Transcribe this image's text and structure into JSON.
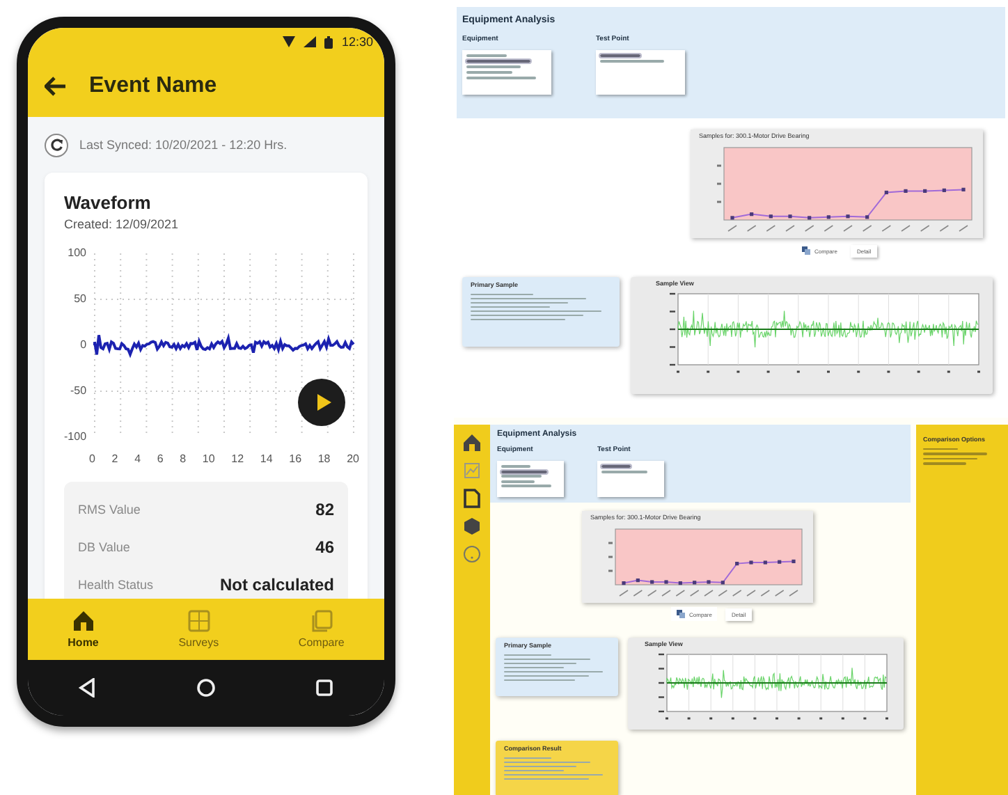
{
  "phone": {
    "status_bar": {
      "time": "12:30"
    },
    "title": "Event Name",
    "sync_status": "Last Synced: 10/20/2021 - 12:20 Hrs.",
    "card": {
      "title": "Waveform",
      "created": "Created: 12/09/2021",
      "y_labels": [
        "100",
        "50",
        "0",
        "-50",
        "-100"
      ],
      "x_labels": [
        "0",
        "2",
        "4",
        "6",
        "8",
        "10",
        "12",
        "14",
        "16",
        "18",
        "20"
      ],
      "stats": [
        {
          "label": "RMS Value",
          "value": "82"
        },
        {
          "label": "DB Value",
          "value": "46"
        },
        {
          "label": "Health Status",
          "value": "Not calculated"
        }
      ]
    },
    "bottom_nav": [
      {
        "kind": "home",
        "label": "Home",
        "selected": true
      },
      {
        "kind": "surveys",
        "label": "Surveys",
        "selected": false
      },
      {
        "kind": "compare",
        "label": "Compare",
        "selected": false
      }
    ]
  },
  "desktop_screens": [
    {
      "kind": "plain",
      "title": "Equipment Analysis",
      "equipment_label": "Equipment",
      "test_point_label": "Test Point",
      "chart_title": "Samples for: 300.1-Motor Drive Bearing",
      "buttons": [
        {
          "kind": "compare",
          "label": "Compare"
        },
        {
          "kind": "detail",
          "label": "Detail"
        }
      ],
      "primary_sample_title": "Primary Sample",
      "sample_view_title": "Sample View"
    },
    {
      "kind": "sidebar",
      "title": "Equipment Analysis",
      "equipment_label": "Equipment",
      "test_point_label": "Test Point",
      "chart_title": "Samples for: 300.1-Motor Drive Bearing",
      "buttons": [
        {
          "kind": "compare",
          "label": "Compare"
        },
        {
          "kind": "detail",
          "label": "Detail"
        }
      ],
      "primary_sample_title": "Primary Sample",
      "sample_view_title": "Sample View",
      "result_title": "Comparison Result",
      "side_panel_title": "Comparison Options"
    }
  ]
}
